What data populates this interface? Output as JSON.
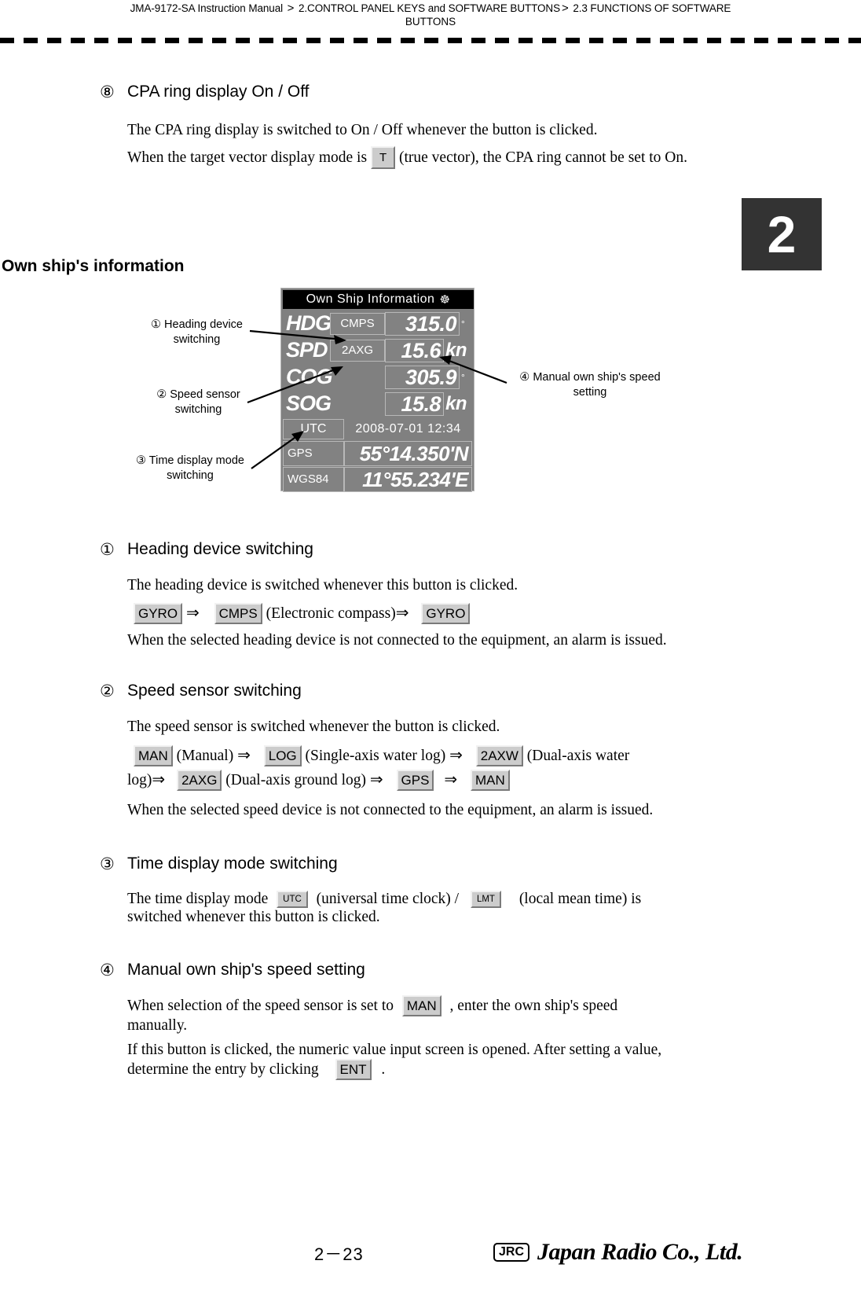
{
  "header": {
    "manual": "JMA-9172-SA Instruction Manual",
    "sep1": ">",
    "chapter": "2.CONTROL PANEL KEYS and SOFTWARE BUTTONS",
    "sep2": ">",
    "section": "2.3  FUNCTIONS OF SOFTWARE",
    "section_wrap": "BUTTONS"
  },
  "chapter_tab": "2",
  "item8": {
    "num": "⑧",
    "title": "CPA ring display On / Off",
    "para1": "The CPA ring display is switched to On / Off whenever the button is clicked.",
    "para2_a": "When the target vector display mode is",
    "key_t": "T",
    "para2_b": "(true vector), the CPA ring cannot be set to",
    "para2_c": "On."
  },
  "own_ship_section_title": "Own ship's information",
  "osi_panel": {
    "title": "Own Ship Information",
    "title_icon": "☸",
    "rows": [
      {
        "label": "HDG",
        "source": "CMPS",
        "value": "315.0",
        "unit": "",
        "degree": "°"
      },
      {
        "label": "SPD",
        "source": "2AXG",
        "value": "15.6",
        "unit": "kn",
        "degree": ""
      },
      {
        "label": "COG",
        "source": "",
        "value": "305.9",
        "unit": "",
        "degree": "°"
      },
      {
        "label": "SOG",
        "source": "",
        "value": "15.8",
        "unit": "kn",
        "degree": ""
      }
    ],
    "utc_label": "UTC",
    "utc_value": "2008-07-01  12:34",
    "geo": [
      {
        "label": "GPS",
        "value": "55°14.350'N"
      },
      {
        "label": "WGS84",
        "value": "11°55.234'E"
      }
    ]
  },
  "callouts": {
    "c1_line1": "① Heading device",
    "c1_line2": "switching",
    "c2_line1": "② Speed sensor",
    "c2_line2": "switching",
    "c3_line1": "③ Time display mode",
    "c3_line2": "switching",
    "c4_line1": "④ Manual own ship's speed",
    "c4_line2": "setting"
  },
  "item1": {
    "num": "①",
    "title": "Heading device switching",
    "para1": "The heading device is switched whenever this button is clicked.",
    "seq": {
      "k1": "GYRO",
      "a1": "⇒",
      "k2": "CMPS",
      "t1": "(Electronic compass)",
      "a2": "⇒",
      "k3": "GYRO"
    },
    "para2": "When the selected heading device is not connected to the equipment, an alarm is issued."
  },
  "item2": {
    "num": "②",
    "title": "Speed sensor switching",
    "para1": "The speed sensor is switched whenever the button is clicked.",
    "seq": {
      "k1": "MAN",
      "t1": "(Manual)",
      "a1": "⇒",
      "k2": "LOG",
      "t2": "(Single-axis water log)",
      "a2": "⇒",
      "k3": "2AXW",
      "t3": "(Dual-axis water",
      "t3b": "log)",
      "a3": "⇒",
      "k4": "2AXG",
      "t4": "(Dual-axis ground log)",
      "a4": "⇒",
      "k5": "GPS",
      "a5": "⇒",
      "k6": "MAN"
    },
    "para2": "When the selected speed device is not connected to the equipment, an alarm is issued."
  },
  "item3": {
    "num": "③",
    "title": "Time display mode switching",
    "para_a": "The time display mode",
    "key_utc": "UTC",
    "para_b": "(universal time clock) /",
    "key_lmt": "LMT",
    "para_c": "(local mean time) is",
    "para_d": "switched whenever this button is clicked."
  },
  "item4": {
    "num": "④",
    "title": "Manual own ship's speed setting",
    "para1_a": "When selection of the speed sensor is set to",
    "key_man": "MAN",
    "para1_b": ", enter the own ship's speed",
    "para1_c": "manually.",
    "para2_a": "If this button is clicked, the numeric value input screen is opened. After setting a value,",
    "para2_b": "determine the entry by clicking",
    "key_ent": "ENT",
    "para2_c": "."
  },
  "footer": {
    "page": "2－23",
    "logo_box": "JRC",
    "logo_name": "Japan Radio Co., Ltd."
  }
}
